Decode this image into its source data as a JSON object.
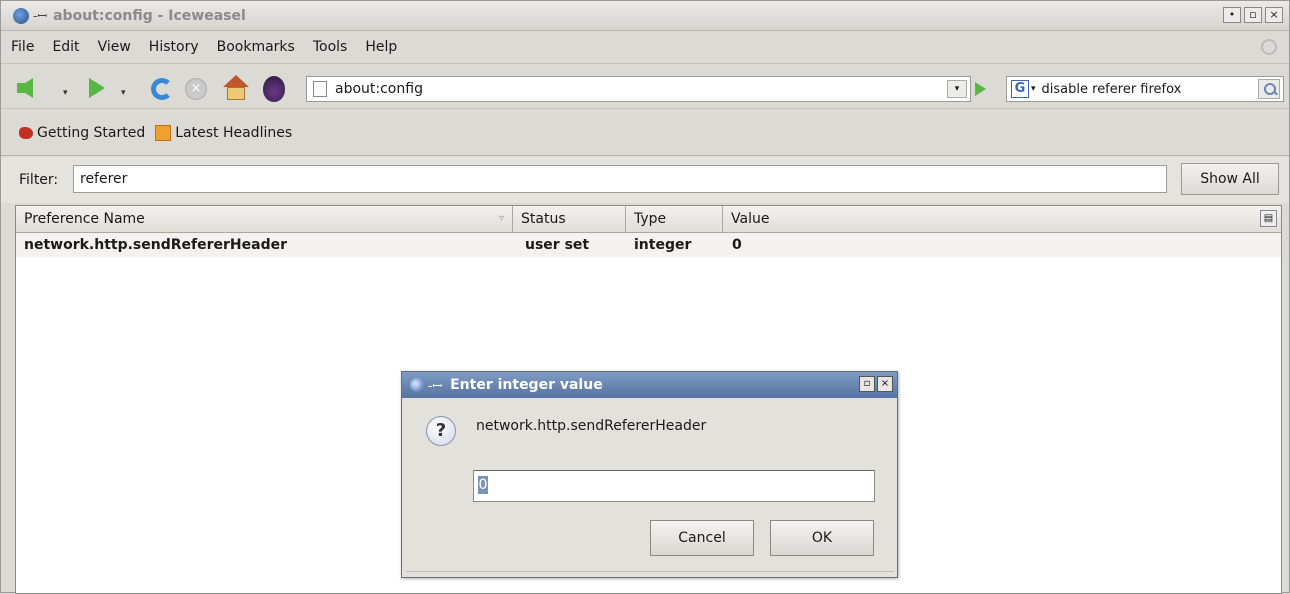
{
  "window": {
    "title": "about:config - Iceweasel",
    "pin_glyph": "-ꟷ",
    "controls": [
      "•",
      "▫",
      "×"
    ]
  },
  "menu": {
    "items": [
      "File",
      "Edit",
      "View",
      "History",
      "Bookmarks",
      "Tools",
      "Help"
    ]
  },
  "navbar": {
    "url": "about:config",
    "search_engine_letter": "G",
    "search_value": "disable referer firefox",
    "dropdown_glyph": "▾"
  },
  "bookmarks": {
    "items": [
      "Getting Started",
      "Latest Headlines"
    ]
  },
  "filter": {
    "label": "Filter:",
    "value": "referer",
    "show_all_label": "Show All"
  },
  "table": {
    "columns": [
      "Preference Name",
      "Status",
      "Type",
      "Value"
    ],
    "sort_glyph": "▿",
    "colpicker_glyph": "▤",
    "rows": [
      {
        "name": "network.http.sendRefererHeader",
        "status": "user set",
        "type": "integer",
        "value": "0"
      }
    ]
  },
  "dialog": {
    "title": "Enter integer value",
    "message": "network.http.sendRefererHeader",
    "input_value": "0",
    "cancel_label": "Cancel",
    "ok_label": "OK",
    "question_glyph": "?",
    "pin_glyph": "-ꟷ",
    "controls": [
      "▫",
      "×"
    ]
  },
  "colors": {
    "window_bg": "#dcdad5",
    "dialog_title_bg": "#56739f",
    "nav_green": "#59b546",
    "reload_blue": "#3b89d6",
    "selection": "#7b92b9"
  }
}
